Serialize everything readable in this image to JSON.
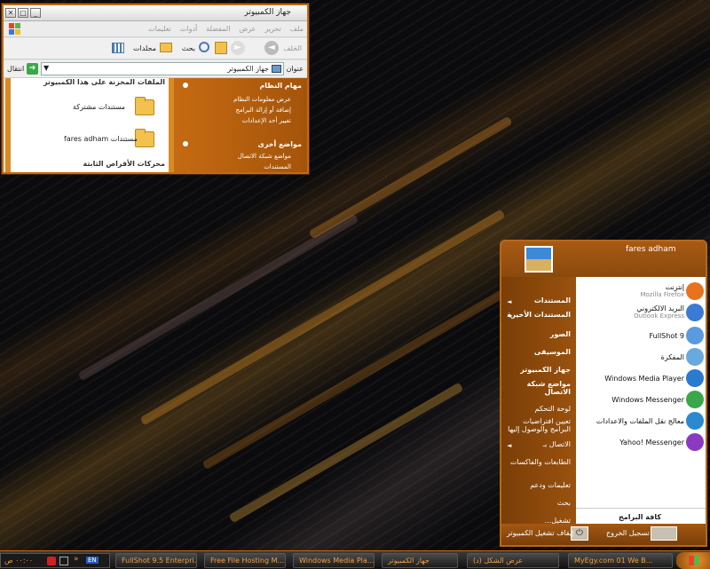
{
  "explorer": {
    "title": "جهاز الكمبيوتر",
    "menu": [
      "ملف",
      "تحرير",
      "عرض",
      "المفضلة",
      "أدوات",
      "تعليمات"
    ],
    "toolbar": {
      "back": "الخلف",
      "search": "بحث",
      "folders": "مجلدات"
    },
    "address_label": "عنوان",
    "address_value": "جهاز الكمبيوتر",
    "go_label": "انتقال",
    "files_header": "الملفات المخزنة على هذا الكمبيوتر",
    "folders": [
      "مستندات مشتركة",
      "fares adham مستندات"
    ],
    "drives_header": "محركات الأقراص الثابتة",
    "tasks": {
      "system_title": "مهام النظام",
      "system_items": [
        "عرض معلومات النظام",
        "إضافة أو إزالة البرامج",
        "تغيير أحد الإعدادات"
      ],
      "other_title": "مواضع أخرى",
      "other_items": [
        "مواضع شبكة الاتصال",
        "المستندات"
      ]
    }
  },
  "start_menu": {
    "user": "fares adham",
    "left_items": [
      {
        "label": "المستندات",
        "arrow": true,
        "bold": true
      },
      {
        "label": "المستندات الأخيرة",
        "arrow": true,
        "bold": true
      },
      {
        "label": "الصور",
        "arrow": false,
        "bold": true
      },
      {
        "label": "الموسيقى",
        "arrow": false,
        "bold": true
      },
      {
        "label": "جهاز الكمبيوتر",
        "arrow": false,
        "bold": true
      },
      {
        "label": "مواضع شبكة الاتصال",
        "arrow": false,
        "bold": true
      },
      {
        "label": "لوحة التحكم",
        "arrow": false,
        "bold": false
      },
      {
        "label": "تعيين افتراضيات البرامج والوصول إليها",
        "arrow": false,
        "bold": false
      },
      {
        "label": "الاتصال بـ",
        "arrow": true,
        "bold": false
      },
      {
        "label": "الطابعات والفاكسات",
        "arrow": false,
        "bold": false
      },
      {
        "label": "تعليمات ودعم",
        "arrow": false,
        "bold": false
      },
      {
        "label": "بحث",
        "arrow": false,
        "bold": false
      },
      {
        "label": "تشغيل...",
        "arrow": false,
        "bold": false
      }
    ],
    "right_items": [
      {
        "label": "إنترنت",
        "sub": "Mozilla Firefox",
        "color": "#e8731c"
      },
      {
        "label": "البريد الالكتروني",
        "sub": "Outlook Express",
        "color": "#3a7bd5"
      },
      {
        "label": "FullShot 9",
        "sub": "",
        "color": "#5a9be0"
      },
      {
        "label": "المفكرة",
        "sub": "",
        "color": "#6aa8e0"
      },
      {
        "label": "Windows Media Player",
        "sub": "",
        "color": "#2a7ad0"
      },
      {
        "label": "Windows Messenger",
        "sub": "",
        "color": "#3aa84a"
      },
      {
        "label": "معالج نقل الملفات والاعدادات",
        "sub": "",
        "color": "#2a8ad0"
      },
      {
        "label": "Yahoo! Messenger",
        "sub": "",
        "color": "#8a3ac0"
      }
    ],
    "all_programs": "كافة البرامج",
    "logoff": "تسجيل الخروج",
    "shutdown": "إيقاف تشغيل الكمبيوتر"
  },
  "taskbar": {
    "tasks": [
      "MyEgy.com 01 We B...",
      "عرض الشكل (د)",
      "جهاز الكمبيوتر",
      "Windows Media Pla...",
      "Free File Hosting M...",
      "FullShot 9.5 Enterpri..."
    ],
    "clock": "٠٠:٠٠ ص",
    "lang": "EN"
  }
}
